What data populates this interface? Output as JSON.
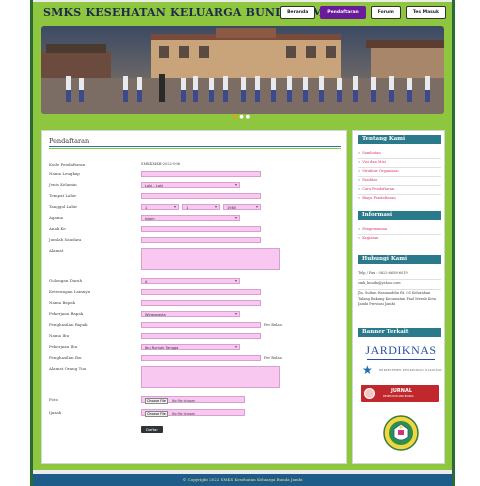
{
  "site": {
    "title": "SMKS KESEHATAN KELUARGA BUNDA JAMBI"
  },
  "topnav": [
    {
      "label": "Beranda",
      "active": false
    },
    {
      "label": "Pendaftaran",
      "active": true
    },
    {
      "label": "Forum",
      "active": false
    },
    {
      "label": "Tes Masuk",
      "active": false
    }
  ],
  "banner": {
    "slides": 3,
    "active_slide": 0
  },
  "form": {
    "title": "Pendaftaran",
    "fields": [
      {
        "label": "Kode Pendaftaran",
        "type": "text-static",
        "value": "SMKKMKB-2022-006"
      },
      {
        "label": "Nama Lengkap",
        "type": "input",
        "value": ""
      },
      {
        "label": "Jenis Kelamin",
        "type": "select",
        "value": "Laki - Laki"
      },
      {
        "label": "Tempat Lahir",
        "type": "input",
        "value": ""
      },
      {
        "label": "Tanggal Lahir",
        "type": "date",
        "day": "1",
        "month": "1",
        "year": "1985"
      },
      {
        "label": "Agama",
        "type": "select",
        "value": "Islam"
      },
      {
        "label": "Anak Ke",
        "type": "input",
        "value": ""
      },
      {
        "label": "Jumlah Saudara",
        "type": "input",
        "value": ""
      },
      {
        "label": "Alamat",
        "type": "textarea",
        "value": ""
      },
      {
        "label": "Golongan Darah",
        "type": "select",
        "value": "A"
      },
      {
        "label": "Keterangan Lainnya",
        "type": "input",
        "value": ""
      },
      {
        "label": "Nama Bapak",
        "type": "input",
        "value": ""
      },
      {
        "label": "Pekerjaan Bapak",
        "type": "select",
        "value": "Wiraswasta"
      },
      {
        "label": "Penghasilan Bapak",
        "type": "input",
        "value": "",
        "suffix": "Per Bulan"
      },
      {
        "label": "Nama Ibu",
        "type": "input",
        "value": ""
      },
      {
        "label": "Pekerjaan Ibu",
        "type": "select",
        "value": "Ibu Rumah Tangga"
      },
      {
        "label": "Penghasilan Ibu",
        "type": "input",
        "value": "",
        "suffix": "Per Bulan"
      },
      {
        "label": "Alamat Orang Tua",
        "type": "textarea",
        "value": ""
      },
      {
        "label": "Foto",
        "type": "file",
        "choose": "Choose File",
        "nofile": "No file chosen"
      },
      {
        "label": "Ijazah",
        "type": "file",
        "choose": "Choose File",
        "nofile": "No file chosen"
      }
    ],
    "submit_label": "Daftar"
  },
  "sidebar": {
    "about_title": "Tentang Kami",
    "about_links": [
      "Sambutan",
      "Visi dan Misi",
      "Struktur Organisasi",
      "Fasilitas",
      "Cara Pendaftaran",
      "Biaya Pendaftaran"
    ],
    "info_title": "Informasi",
    "info_links": [
      "Pengumuman",
      "Kegiatan"
    ],
    "contact_title": "Hubungi Kami",
    "contact_phone": "Telp / Fax : 0822-6658-6019",
    "contact_email": "smk_bunda@yahoo.com",
    "contact_address": "Jln. Sultan Hasanuddin Rt. 05 Kelurahan Talang Bakung Kecamatan Paal Merah Kota Jambi Provinsi Jambi",
    "banner_title": "Banner Terkait",
    "logo_jardiknas": "JARDIKNAS",
    "logo_dept": "DEPARTEMEN PENDIDIKAN NASIONAL",
    "logo_jurnal": "JURNAL",
    "logo_jurnal_sub": "KESEHATAN SMK BUNDA"
  },
  "footer": {
    "text": "© Copyright 2022 SMKS Kesehatan Keluarga Bunda Jambi"
  },
  "colors": {
    "accent_green": "#8ec63f",
    "heading_teal": "#2a7a8c",
    "field_pink": "#f8c8f0",
    "nav_active": "#6a1b9a",
    "footer_blue": "#1e5c8a"
  }
}
